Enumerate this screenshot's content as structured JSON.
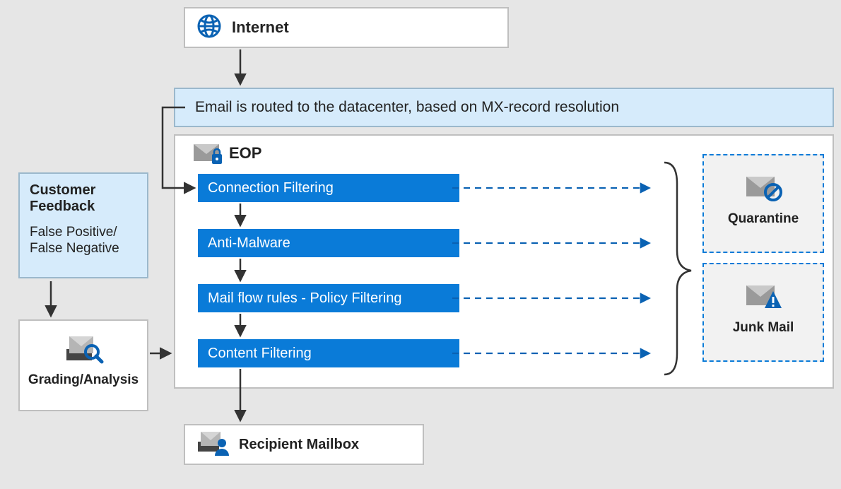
{
  "internet": {
    "label": "Internet"
  },
  "routing_banner": {
    "text": "Email is routed to the datacenter, based on MX-record resolution"
  },
  "eop": {
    "title": "EOP",
    "stages": [
      {
        "label": "Connection Filtering"
      },
      {
        "label": "Anti-Malware"
      },
      {
        "label": "Mail flow rules - Policy Filtering"
      },
      {
        "label": "Content Filtering"
      }
    ]
  },
  "outcomes": {
    "quarantine": "Quarantine",
    "junk": "Junk Mail"
  },
  "recipient_box": {
    "label": "Recipient Mailbox"
  },
  "feedback": {
    "title": "Customer Feedback",
    "subtitle": "False Positive/ False Negative"
  },
  "grading": {
    "label": "Grading/Analysis"
  }
}
